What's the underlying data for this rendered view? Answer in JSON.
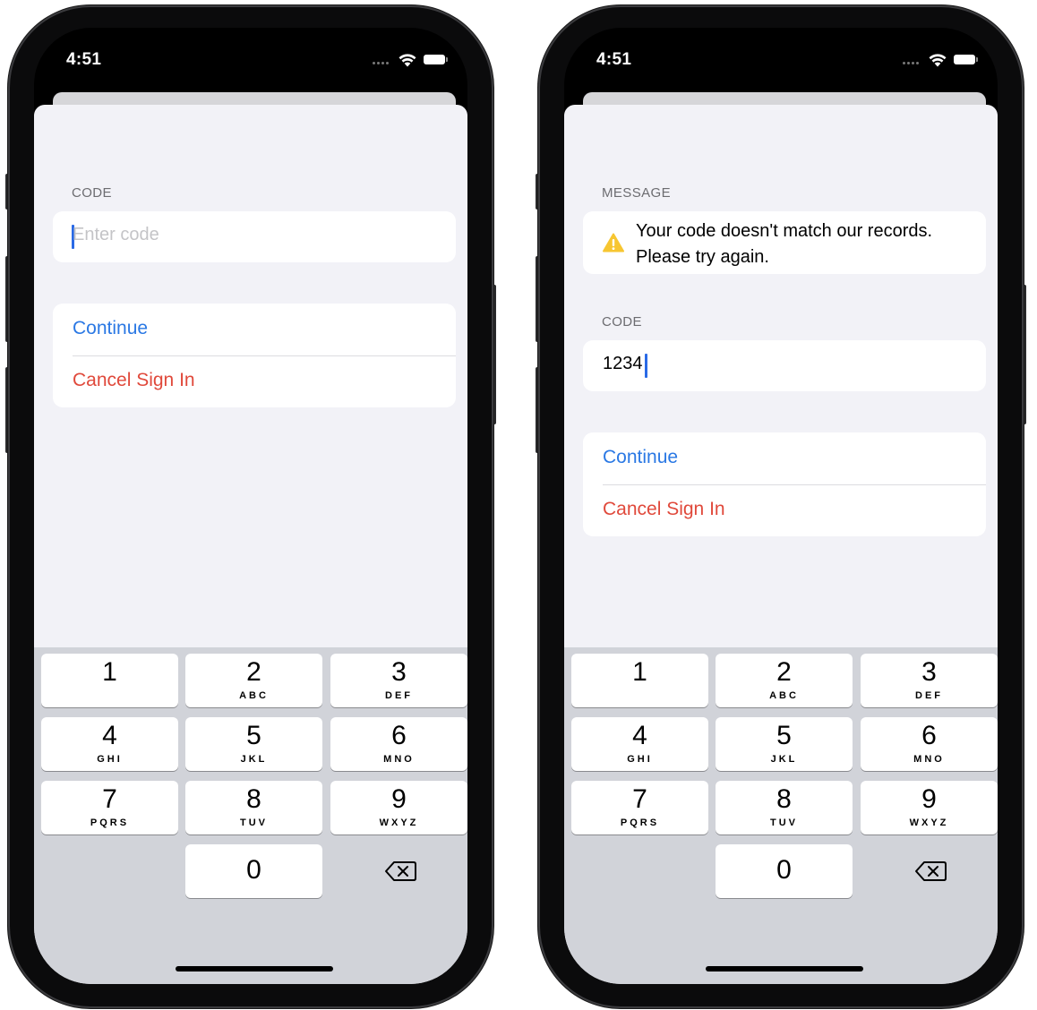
{
  "left": {
    "status_time": "4:51",
    "code_header": "CODE",
    "code_placeholder": "Enter code",
    "continue_label": "Continue",
    "cancel_label": "Cancel Sign In"
  },
  "right": {
    "status_time": "4:51",
    "message_header": "MESSAGE",
    "message_text": "Your code doesn't match our records. Please try again.",
    "code_header": "CODE",
    "code_value": "1234",
    "continue_label": "Continue",
    "cancel_label": "Cancel Sign In"
  },
  "keypad": {
    "keys": [
      {
        "digit": "1",
        "letters": ""
      },
      {
        "digit": "2",
        "letters": "ABC"
      },
      {
        "digit": "3",
        "letters": "DEF"
      },
      {
        "digit": "4",
        "letters": "GHI"
      },
      {
        "digit": "5",
        "letters": "JKL"
      },
      {
        "digit": "6",
        "letters": "MNO"
      },
      {
        "digit": "7",
        "letters": "PQRS"
      },
      {
        "digit": "8",
        "letters": "TUV"
      },
      {
        "digit": "9",
        "letters": "WXYZ"
      },
      {
        "digit": "0",
        "letters": ""
      }
    ]
  },
  "colors": {
    "accent_blue": "#2a78e4",
    "destructive_red": "#e0493b",
    "warning_yellow": "#f7c631",
    "grouped_background": "#f2f2f7",
    "keyboard_background": "#d1d3d9"
  }
}
